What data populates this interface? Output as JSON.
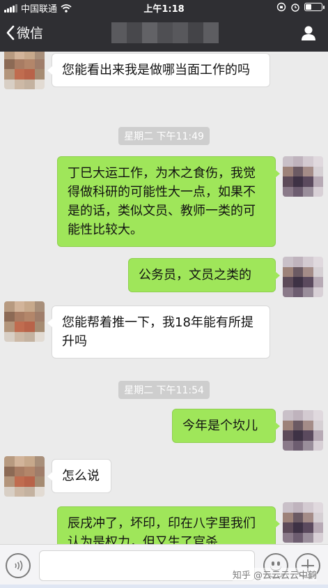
{
  "status_bar": {
    "carrier": "中国联通",
    "time": "上午1:18",
    "battery_level": 0.35
  },
  "nav": {
    "back_label": "微信"
  },
  "messages": [
    {
      "side": "in",
      "text": "您能看出来我是做哪当面工作的吗"
    },
    {
      "type": "timestamp",
      "text": "星期二 下午11:49"
    },
    {
      "side": "out",
      "text": "丁巳大运工作，为木之食伤，我觉得做科研的可能性大一点，如果不是的话，类似文员、教师一类的可能性比较大。"
    },
    {
      "side": "out",
      "text": "公务员，文员之类的"
    },
    {
      "side": "in",
      "text": "您能帮着推一下，我18年能有所提升吗"
    },
    {
      "type": "timestamp",
      "text": "星期二 下午11:54"
    },
    {
      "side": "out",
      "text": "今年是个坎儿"
    },
    {
      "side": "in",
      "text": "怎么说"
    },
    {
      "side": "out",
      "text": "辰戌冲了，坏印，印在八字里我们认为是权力，但又生了官杀"
    }
  ],
  "input_bar": {
    "text_value": ""
  },
  "watermark": "知乎 @云云云云中鹤",
  "colors": {
    "nav_bg": "#2f2f33",
    "chat_bg": "#ebebeb",
    "bubble_out": "#9fe65a",
    "bubble_in": "#ffffff"
  }
}
